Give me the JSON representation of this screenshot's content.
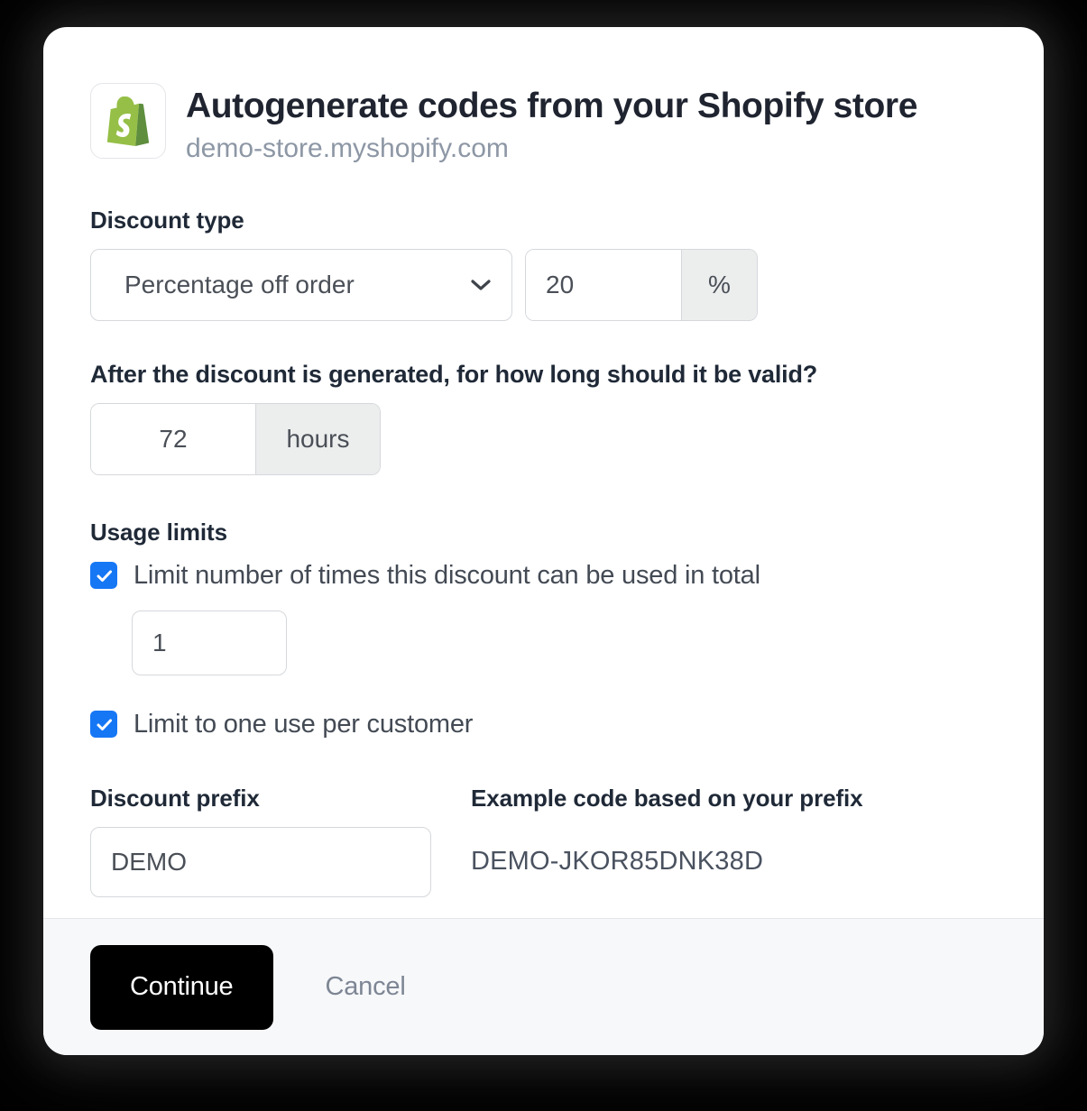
{
  "store": {
    "logo_icon": "shopify-bag-icon",
    "title": "Autogenerate codes from your Shopify store",
    "domain": "demo-store.myshopify.com"
  },
  "discount_type": {
    "label": "Discount type",
    "selected_option": "Percentage off order",
    "options": [
      "Percentage off order"
    ],
    "dropdown_icon": "chevron-down-icon",
    "amount_value": "20",
    "amount_suffix": "%"
  },
  "validity": {
    "question": "After the discount is generated, for how long should it be valid?",
    "duration_value": "72",
    "duration_suffix": "hours"
  },
  "usage_limits": {
    "heading": "Usage limits",
    "total_limit": {
      "label": "Limit number of times this discount can be used in total",
      "checked": true,
      "check_icon": "checkmark-icon",
      "count_value": "1"
    },
    "per_customer": {
      "label": "Limit to one use per customer",
      "checked": true,
      "check_icon": "checkmark-icon"
    }
  },
  "prefix": {
    "label": "Discount prefix",
    "value": "DEMO",
    "example_label": "Example code based on your prefix",
    "example_value": "DEMO-JKOR85DNK38D"
  },
  "footer": {
    "continue_label": "Continue",
    "cancel_label": "Cancel"
  },
  "colors": {
    "accent_checkbox": "#1677f5",
    "primary_button": "#000000",
    "shopify_green": "#95bf47",
    "shopify_green_dark": "#5e8e3e",
    "text_primary": "#1f2937",
    "text_muted": "#8d97a5",
    "footer_background": "#f7f8fa",
    "border": "#d5d8dc"
  }
}
